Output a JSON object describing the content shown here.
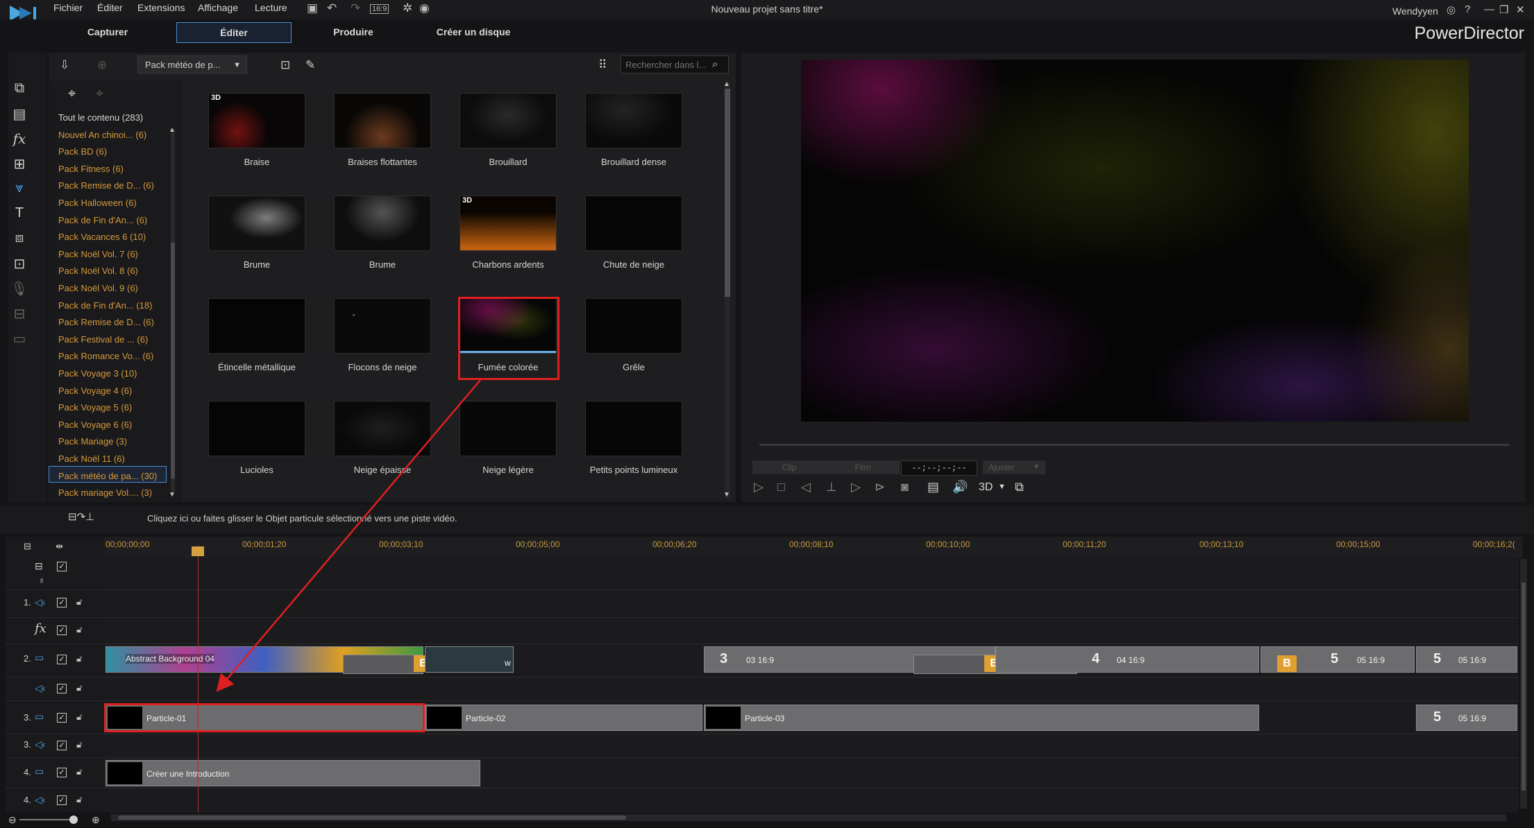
{
  "app": {
    "title": "Nouveau projet sans titre*",
    "brand": "PowerDirector",
    "user": "Wendyyen"
  },
  "menu": [
    "Fichier",
    "Éditer",
    "Extensions",
    "Affichage",
    "Lecture"
  ],
  "toolbar_icons": [
    "save-icon",
    "undo-icon",
    "redo-icon",
    "aspect-ratio-icon",
    "settings-icon",
    "update-icon"
  ],
  "aspect_label": "16:9",
  "window_controls": [
    "user-icon",
    "help-icon",
    "minimize-icon",
    "restore-icon",
    "close-icon"
  ],
  "modes": [
    "Capturer",
    "Éditer",
    "Produire",
    "Créer un disque"
  ],
  "active_mode": "Éditer",
  "library": {
    "dropdown": "Pack météo de p...",
    "search_placeholder": "Rechercher dans l...",
    "categories": [
      "Tout le contenu (283)",
      "Nouvel An chinoi... (6)",
      "Pack BD (6)",
      "Pack Fitness (6)",
      "Pack Remise de D... (6)",
      "Pack Halloween (6)",
      "Pack de Fin d'An... (6)",
      "Pack Vacances 6 (10)",
      "Pack Noël Vol. 7 (6)",
      "Pack Noël Vol. 8 (6)",
      "Pack Noël Vol. 9 (6)",
      "Pack de Fin d'An... (18)",
      "Pack Remise de D... (6)",
      "Pack Festival de ... (6)",
      "Pack Romance Vo... (6)",
      "Pack Voyage 3 (10)",
      "Pack Voyage 4 (6)",
      "Pack Voyage 5 (6)",
      "Pack Voyage 6 (6)",
      "Pack Mariage (3)",
      "Pack Noël 11 (6)",
      "Pack météo de pa... (30)",
      "Pack mariage Vol.... (3)"
    ],
    "selected_category": "Pack météo de pa... (30)",
    "items": [
      {
        "label": "Braise",
        "badge": "3D"
      },
      {
        "label": "Braises flottantes",
        "badge": ""
      },
      {
        "label": "Brouillard",
        "badge": ""
      },
      {
        "label": "Brouillard dense",
        "badge": ""
      },
      {
        "label": "Brume",
        "badge": ""
      },
      {
        "label": "Brume",
        "badge": ""
      },
      {
        "label": "Charbons ardents",
        "badge": "3D"
      },
      {
        "label": "Chute de neige",
        "badge": ""
      },
      {
        "label": "Étincelle métallique",
        "badge": ""
      },
      {
        "label": "Flocons de neige",
        "badge": ""
      },
      {
        "label": "Fumée colorée",
        "badge": ""
      },
      {
        "label": "Grêle",
        "badge": ""
      },
      {
        "label": "Lucioles",
        "badge": ""
      },
      {
        "label": "Neige épaisse",
        "badge": ""
      },
      {
        "label": "Neige légère",
        "badge": ""
      },
      {
        "label": "Petits points lumineux",
        "badge": ""
      }
    ],
    "selected_item": "Fumée colorée"
  },
  "preview": {
    "clip_btn": "Clip",
    "film_btn": "Film",
    "timecode": "--;--;--;--",
    "fit": "Ajuster",
    "mode_3d": "3D"
  },
  "status": "Cliquez ici ou faites glisser le Objet particule sélectionné vers une piste vidéo.",
  "timeline": {
    "ticks": [
      "00;00;00;00",
      "00;00;01;20",
      "00;00;03;10",
      "00;00;05;00",
      "00;00;06;20",
      "00;00;08;10",
      "00;00;10;00",
      "00;00;11;20",
      "00;00;13;10",
      "00;00;15;00",
      "00;00;16;2("
    ],
    "tracks": [
      "1.",
      "2.",
      "3.",
      "3.",
      "4.",
      "4."
    ],
    "fx_label": "fx",
    "clips": {
      "abstract": "Abstract Background 04",
      "particle1": "Particle-01",
      "particle2": "Particle-02",
      "particle3": "Particle-03",
      "intro": "Créer une Introduction",
      "t3": "3",
      "t3_sub": "03 16:9",
      "t4": "4",
      "t4_sub": "04 16:9",
      "t5a": "5",
      "t5a_sub": "05 16:9",
      "t5b": "5",
      "t5b_sub": "05 16:9",
      "t5c": "5",
      "t5c_sub": "05 16:9",
      "b": "B",
      "w": "w"
    }
  },
  "colors": {
    "accent_blue": "#4a8fd8",
    "category_orange": "#d69a3c",
    "highlight_red": "#e02020",
    "playhead": "#b0302a"
  }
}
